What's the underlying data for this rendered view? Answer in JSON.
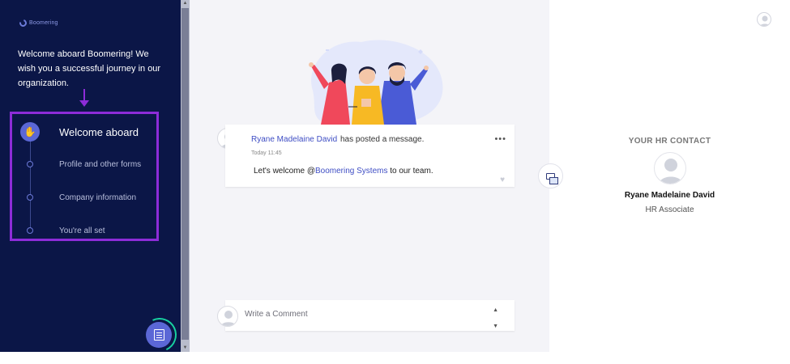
{
  "sidebar": {
    "logo_text": "Boomering",
    "welcome_message": "Welcome aboard Boomering! We wish you a successful journey in our organization.",
    "steps": [
      {
        "label": "Welcome aboard",
        "active": true
      },
      {
        "label": "Profile and other forms",
        "active": false
      },
      {
        "label": "Company information",
        "active": false
      },
      {
        "label": "You're all set",
        "active": false
      }
    ]
  },
  "post": {
    "author": "Ryane Madelaine David",
    "action": "has posted a message.",
    "time": "Today 11:45",
    "body_prefix": "Let's welcome @",
    "mention": "Boomering Systems",
    "body_suffix": " to our team.",
    "menu_icon": "more-icon",
    "like_icon": "heart-icon"
  },
  "comment": {
    "placeholder": "Write a Comment"
  },
  "hr_contact": {
    "heading": "YOUR HR CONTACT",
    "name": "Ryane Madelaine David",
    "role": "HR Associate"
  },
  "colors": {
    "sidebar_bg": "#0b1647",
    "accent": "#5b67d6",
    "highlight": "#8d2cd8",
    "link": "#3f4ec4"
  }
}
